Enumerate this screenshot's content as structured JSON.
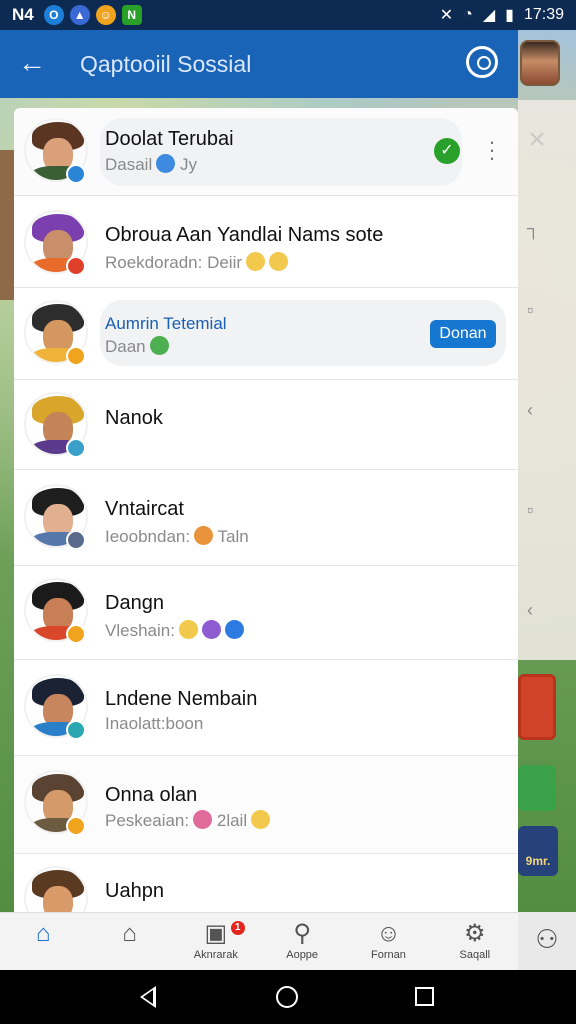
{
  "status_bar": {
    "carrier": "N4",
    "time": "17:39"
  },
  "header": {
    "title": "Qaptooiil Sossial"
  },
  "contacts": [
    {
      "name": "Doolat Terubai",
      "status": "Dasail",
      "status_suffix": "Jy",
      "emojis": [
        "#3d8be0"
      ],
      "badge_color": "#2a85d6",
      "avatar": {
        "hair": "#5a3522",
        "face": "#d9a07a",
        "shirt": "#3b5e36"
      }
    },
    {
      "name": "Obroua Aan Yandlai Nams sote",
      "status": "Roekdoradn: Deiir",
      "status_suffix": "",
      "emojis": [
        "#f2c94c",
        "#f2c94c"
      ],
      "badge_color": "#e0402a",
      "avatar": {
        "hair": "#7b3fae",
        "face": "#c98e6a",
        "shirt": "#e86b2c"
      }
    },
    {
      "name": "Aumrin Tetemial",
      "status": "Daan",
      "status_suffix": "",
      "emojis": [
        "#4caf50"
      ],
      "badge_color": "#f0a41e",
      "avatar": {
        "hair": "#2d2d2d",
        "face": "#d4975f",
        "shirt": "#f0b33a"
      },
      "action_label": "Donan"
    },
    {
      "name": "Nanok",
      "status": "",
      "status_suffix": "",
      "emojis": [],
      "badge_color": "#3aa0c9",
      "avatar": {
        "hair": "#d7a62b",
        "face": "#c58458",
        "shirt": "#5b3a8c"
      }
    },
    {
      "name": "Vntaircat",
      "status": "Ieoobndan:",
      "status_suffix": "Taln",
      "emojis": [
        "#e9933a"
      ],
      "badge_color": "#5a6a8a",
      "avatar": {
        "hair": "#1e1e1e",
        "face": "#e0b090",
        "shirt": "#5577aa"
      }
    },
    {
      "name": "Dangn",
      "status": "Vleshain:",
      "status_suffix": "",
      "emojis": [
        "#f2c94c",
        "#8e5bd1",
        "#2d7be0"
      ],
      "badge_color": "#f0a41e",
      "avatar": {
        "hair": "#1b1b1b",
        "face": "#c97f55",
        "shirt": "#d9472b"
      }
    },
    {
      "name": "Lndene Nembain",
      "status": "Inaolatt:boon",
      "status_suffix": "",
      "emojis": [],
      "badge_color": "#2aa7b0",
      "avatar": {
        "hair": "#1a2233",
        "face": "#c8865f",
        "shirt": "#2a7fc9"
      }
    },
    {
      "name": "Onna olan",
      "status": "Peskeaian:",
      "status_suffix": "2lail",
      "emojis": [
        "#e06a9a",
        "#f2c94c"
      ],
      "badge_color": "#f0a41e",
      "avatar": {
        "hair": "#5a4332",
        "face": "#d49a6a",
        "shirt": "#6b5b40"
      }
    },
    {
      "name": "Uahpn",
      "status": "",
      "status_suffix": "",
      "emojis": [],
      "badge_color": "#f0a41e",
      "avatar": {
        "hair": "#5b3a22",
        "face": "#d99a6a",
        "shirt": "#8c3a2a"
      }
    }
  ],
  "tabs": [
    {
      "label": "",
      "icon": "home-filled-icon"
    },
    {
      "label": "",
      "icon": "home-outline-icon"
    },
    {
      "label": "Aknrarak",
      "icon": "game-controller-icon",
      "badge": "1"
    },
    {
      "label": "Aoppe",
      "icon": "search-icon"
    },
    {
      "label": "Fornan",
      "icon": "person-chat-icon"
    },
    {
      "label": "Saqall",
      "icon": "settings-gear-icon"
    }
  ],
  "side_card_text": "9mr.",
  "colors": {
    "brand": "#1a64b8",
    "accent": "#1577cf",
    "online": "#28a02a"
  }
}
